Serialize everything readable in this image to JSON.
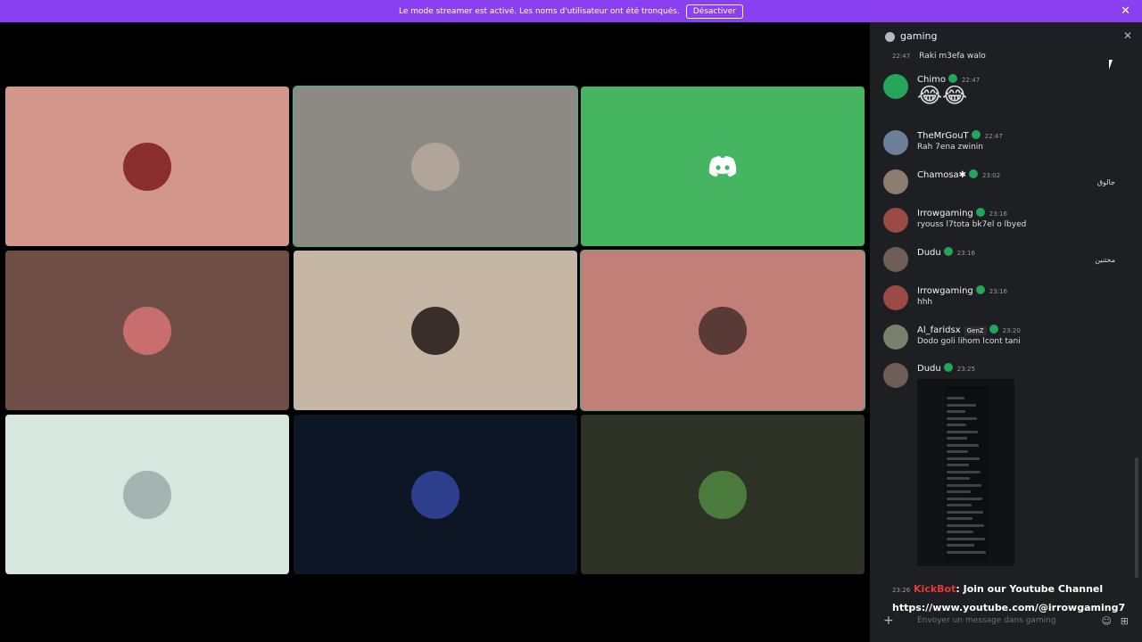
{
  "banner": {
    "message": "Le mode streamer est activé. Les noms d'utilisateur ont été tronqués.",
    "button_label": "Désactiver",
    "close_glyph": "✕"
  },
  "grid": {
    "tiles": [
      {
        "bg": "#d3968b",
        "avatar_color": "#8a2d2d"
      },
      {
        "bg": "#8d8a83",
        "avatar_color": "#b0a598",
        "speaking": true
      },
      {
        "bg": "#46b562",
        "avatar_color": "#46b562",
        "discord": true
      },
      {
        "bg": "#6e4e46",
        "avatar_color": "#c86e6e"
      },
      {
        "bg": "#c5b6a5",
        "avatar_color": "#3a2e2a"
      },
      {
        "bg": "#c27f78",
        "avatar_color": "#5a3a36",
        "speaking": true
      },
      {
        "bg": "#d8e6e0",
        "avatar_color": "#a5b4b0"
      },
      {
        "bg": "#0d1625",
        "avatar_color": "#2d3e8c"
      },
      {
        "bg": "#2c3326",
        "avatar_color": "#4a7a3c"
      }
    ]
  },
  "chat": {
    "channel": "gaming",
    "first_line": {
      "time": "22:47",
      "text": "Raki m3efa walo"
    },
    "messages": [
      {
        "name": "Chimo",
        "time": "22:47",
        "text": "😂😂",
        "avatar_color": "#23a55a",
        "big_emoji": true
      },
      {
        "name": "TheMrGouT",
        "time": "22:47",
        "text": "Rah 7ena zwinin",
        "avatar_color": "#6b7f99"
      },
      {
        "name": "Chamosa✱",
        "time": "23:02",
        "text": "",
        "avatar_color": "#8c7d73",
        "arabic": "جالوق"
      },
      {
        "name": "Irrowgaming",
        "time": "23:16",
        "text": "ryouss l7tota bk7el o lbyed",
        "avatar_color": "#9a4b45"
      },
      {
        "name": "Dudu",
        "time": "23:16",
        "text": "",
        "avatar_color": "#6f5e58",
        "arabic": "مختنين"
      },
      {
        "name": "Irrowgaming",
        "time": "23:16",
        "text": "hhh",
        "avatar_color": "#9a4b45"
      },
      {
        "name": "Al_faridsx",
        "tag": "GenZ",
        "time": "23:20",
        "text": "Dodo goli lihom lcont tani",
        "avatar_color": "#7a7f6e"
      },
      {
        "name": "Dudu",
        "time": "23:25",
        "text": "",
        "avatar_color": "#6f5e58"
      }
    ],
    "kickbot": {
      "time": "23:26",
      "bot_name": "KickBot",
      "message": ": Join our Youtube Channel",
      "link": "https://www.youtube.com/@irrowgaming7"
    },
    "input_placeholder": "Envoyer un message dans gaming"
  }
}
